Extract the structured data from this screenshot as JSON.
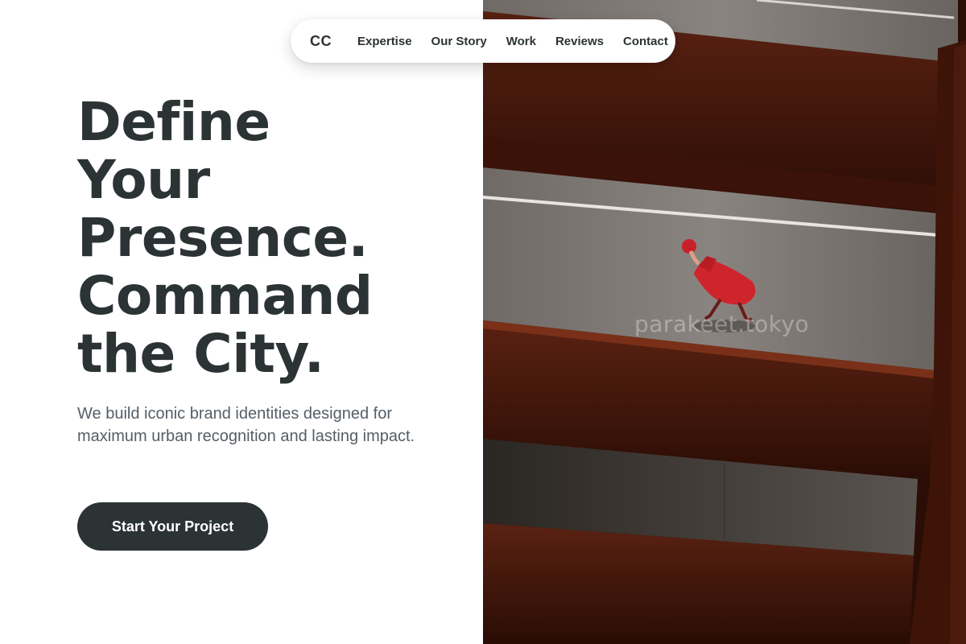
{
  "nav": {
    "logo": "CC",
    "links": [
      "Expertise",
      "Our Story",
      "Work",
      "Reviews",
      "Contact"
    ]
  },
  "hero": {
    "headline_lines": [
      "Define",
      "Your",
      "Presence.",
      "Command",
      "the City."
    ],
    "subtext": "We build iconic brand identities designed for maximum urban recognition and lasting impact.",
    "cta_label": "Start Your Project"
  },
  "photo": {
    "watermark": "parakeet.tokyo"
  },
  "colors": {
    "text_dark": "#2c3334",
    "text_muted": "#555e66",
    "button_bg": "#2c3334",
    "concrete": "#807a76",
    "beam_red": "#4a1a0e",
    "coat_red": "#d0242c"
  }
}
